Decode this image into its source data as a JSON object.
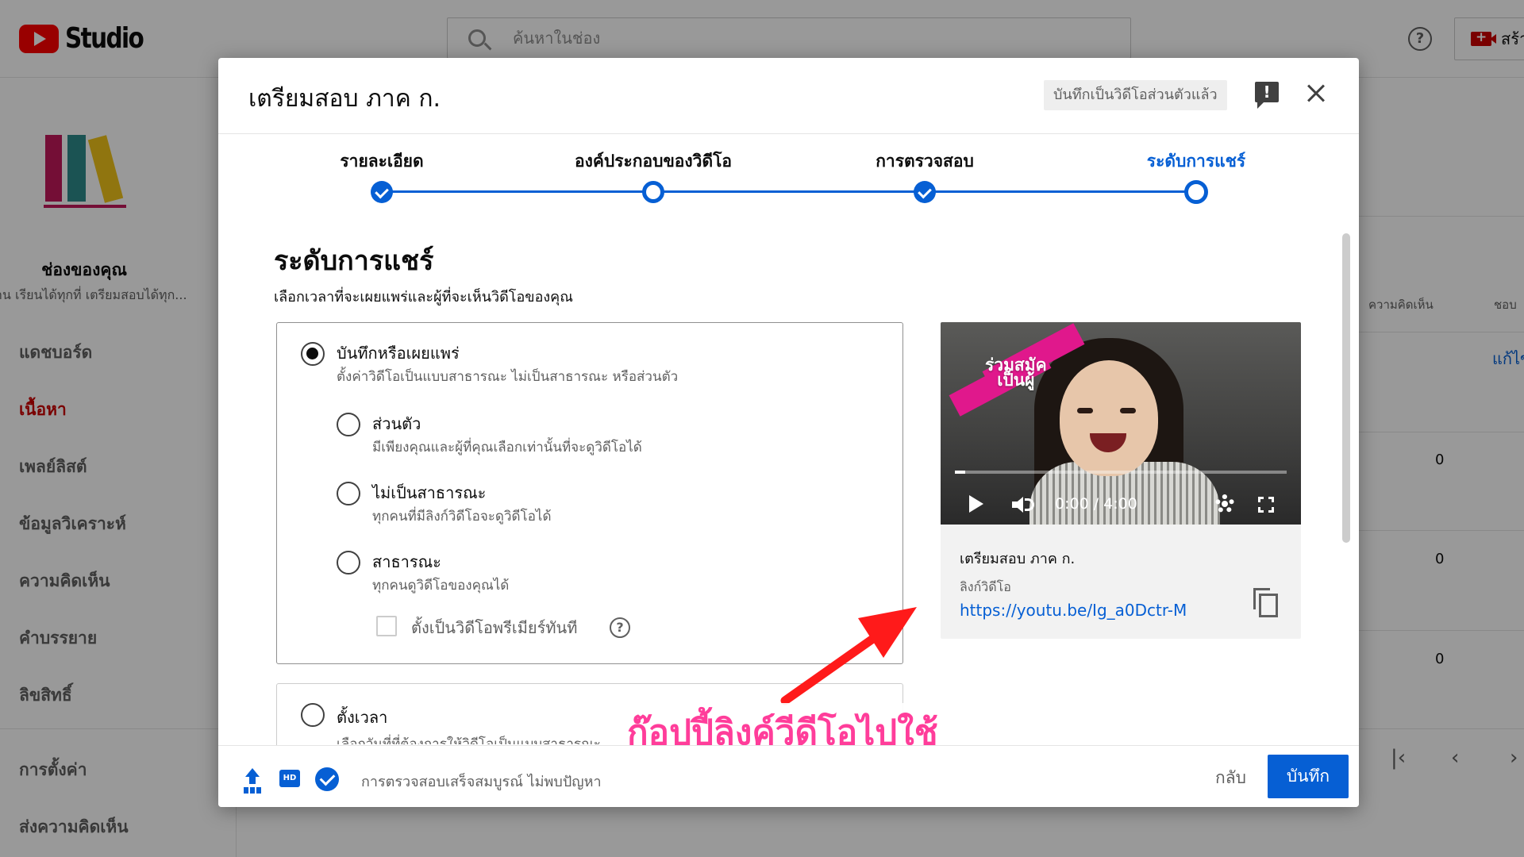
{
  "app": {
    "logo_text": "Studio",
    "search_placeholder": "ค้นหาในช่อง",
    "create_label": "สร้าง"
  },
  "sidebar": {
    "channel_title": "ช่องของคุณ",
    "channel_subtitle": "าน เรียนได้ทุกที่ เตรียมสอบได้ทุก...",
    "items": [
      {
        "label": "แดชบอร์ด",
        "active": false
      },
      {
        "label": "เนื้อหา",
        "active": true
      },
      {
        "label": "เพลย์ลิสต์",
        "active": false
      },
      {
        "label": "ข้อมูลวิเคราะห์",
        "active": false
      },
      {
        "label": "ความคิดเห็น",
        "active": false
      },
      {
        "label": "คำบรรยาย",
        "active": false
      },
      {
        "label": "ลิขสิทธิ์",
        "active": false
      },
      {
        "label": "การตั้งค่า",
        "active": false
      },
      {
        "label": "ส่งความคิดเห็น",
        "active": false
      }
    ]
  },
  "background_table": {
    "col_comments": "ความคิดเห็น",
    "col_likes": "ชอบ",
    "edit_link": "แก้ไข",
    "counts": [
      "0",
      "0",
      "0"
    ]
  },
  "dialog": {
    "title": "เตรียมสอบ ภาค ก.",
    "saved_badge": "บันทึกเป็นวิดีโอส่วนตัวแล้ว",
    "steps": [
      {
        "label": "รายละเอียด",
        "state": "done"
      },
      {
        "label": "องค์ประกอบของวิดีโอ",
        "state": "open"
      },
      {
        "label": "การตรวจสอบ",
        "state": "done"
      },
      {
        "label": "ระดับการแชร์",
        "state": "current"
      }
    ],
    "section_title": "ระดับการแชร์",
    "section_desc": "เลือกเวลาที่จะเผยแพร่และผู้ที่จะเห็นวิดีโอของคุณ",
    "publish_option": {
      "label": "บันทึกหรือเผยแพร่",
      "desc": "ตั้งค่าวิดีโอเป็นแบบสาธารณะ ไม่เป็นสาธารณะ หรือส่วนตัว"
    },
    "visibility_options": [
      {
        "label": "ส่วนตัว",
        "desc": "มีเพียงคุณและผู้ที่คุณเลือกเท่านั้นที่จะดูวิดีโอได้"
      },
      {
        "label": "ไม่เป็นสาธารณะ",
        "desc": "ทุกคนที่มีลิงก์วิดีโอจะดูวิดีโอได้"
      },
      {
        "label": "สาธารณะ",
        "desc": "ทุกคนดูวิดีโอของคุณได้"
      }
    ],
    "premiere_label": "ตั้งเป็นวิดีโอพรีเมียร์ทันที",
    "schedule_option": {
      "label": "ตั้งเวลา",
      "desc": "เลือกวันที่ที่ต้องการให้วิดีโอเป็นแบบสาธารณะ"
    },
    "preview": {
      "thumb_text_line1": "ร่วมสมัค",
      "thumb_text_line2": "เป็นผู้",
      "time": "0:00 / 4:00",
      "progress_fraction": 0.03,
      "video_title": "เตรียมสอบ ภาค ก.",
      "link_label": "ลิงก์วิดีโอ",
      "link_url": "https://youtu.be/Ig_a0Dctr-M"
    },
    "annotation": "ก๊อปปี้ลิงค์วีดีโอไปใช้",
    "footer": {
      "hd_label": "HD",
      "status": "การตรวจสอบเสร็จสมบูรณ์ ไม่พบปัญหา",
      "back_label": "กลับ",
      "save_label": "บันทึก"
    }
  },
  "colors": {
    "accent": "#065fd4",
    "brand_red": "#ff0000",
    "annotation_pink": "#ff3d9a",
    "arrow_red": "#ff1a1a"
  }
}
